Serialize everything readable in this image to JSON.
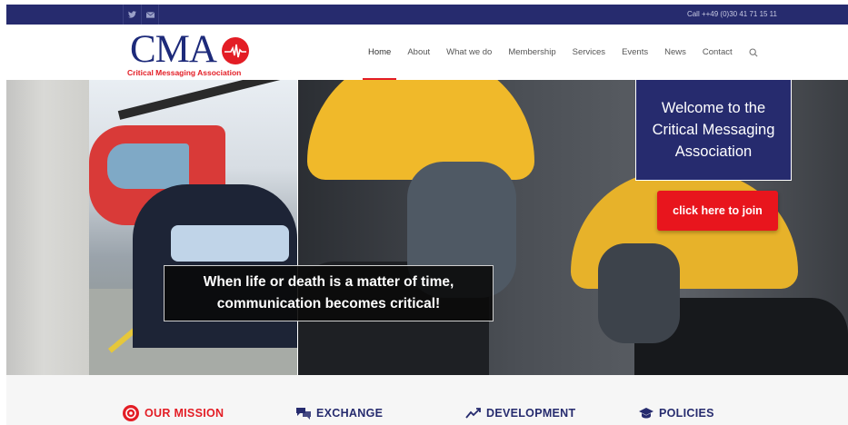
{
  "topbar": {
    "social_icons": [
      "twitter-icon",
      "email-icon"
    ],
    "call_text": "Call ++49 (0)30 41 71 15 11"
  },
  "logo": {
    "letters": "CMA",
    "tagline": "Critical Messaging Association"
  },
  "nav": {
    "items": [
      "Home",
      "About",
      "What we do",
      "Membership",
      "Services",
      "Events",
      "News",
      "Contact"
    ],
    "active": "Home",
    "search_icon": "search-icon"
  },
  "hero": {
    "welcome_text": "Welcome to the\nCritical Messaging\nAssociation",
    "join_label": "click here to join",
    "caption": "When life or death is a matter of time,\ncommunication becomes critical!"
  },
  "features": [
    {
      "label": "OUR MISSION",
      "icon": "mission-icon",
      "color": "#e31d25"
    },
    {
      "label": "EXCHANGE",
      "icon": "chat-icon",
      "color": "#262b6e"
    },
    {
      "label": "DEVELOPMENT",
      "icon": "trend-icon",
      "color": "#262b6e"
    },
    {
      "label": "POLICIES",
      "icon": "graduation-cap-icon",
      "color": "#262b6e"
    }
  ],
  "colors": {
    "navy": "#262b6e",
    "brand_red": "#e31d25",
    "button_red": "#e8151d"
  }
}
